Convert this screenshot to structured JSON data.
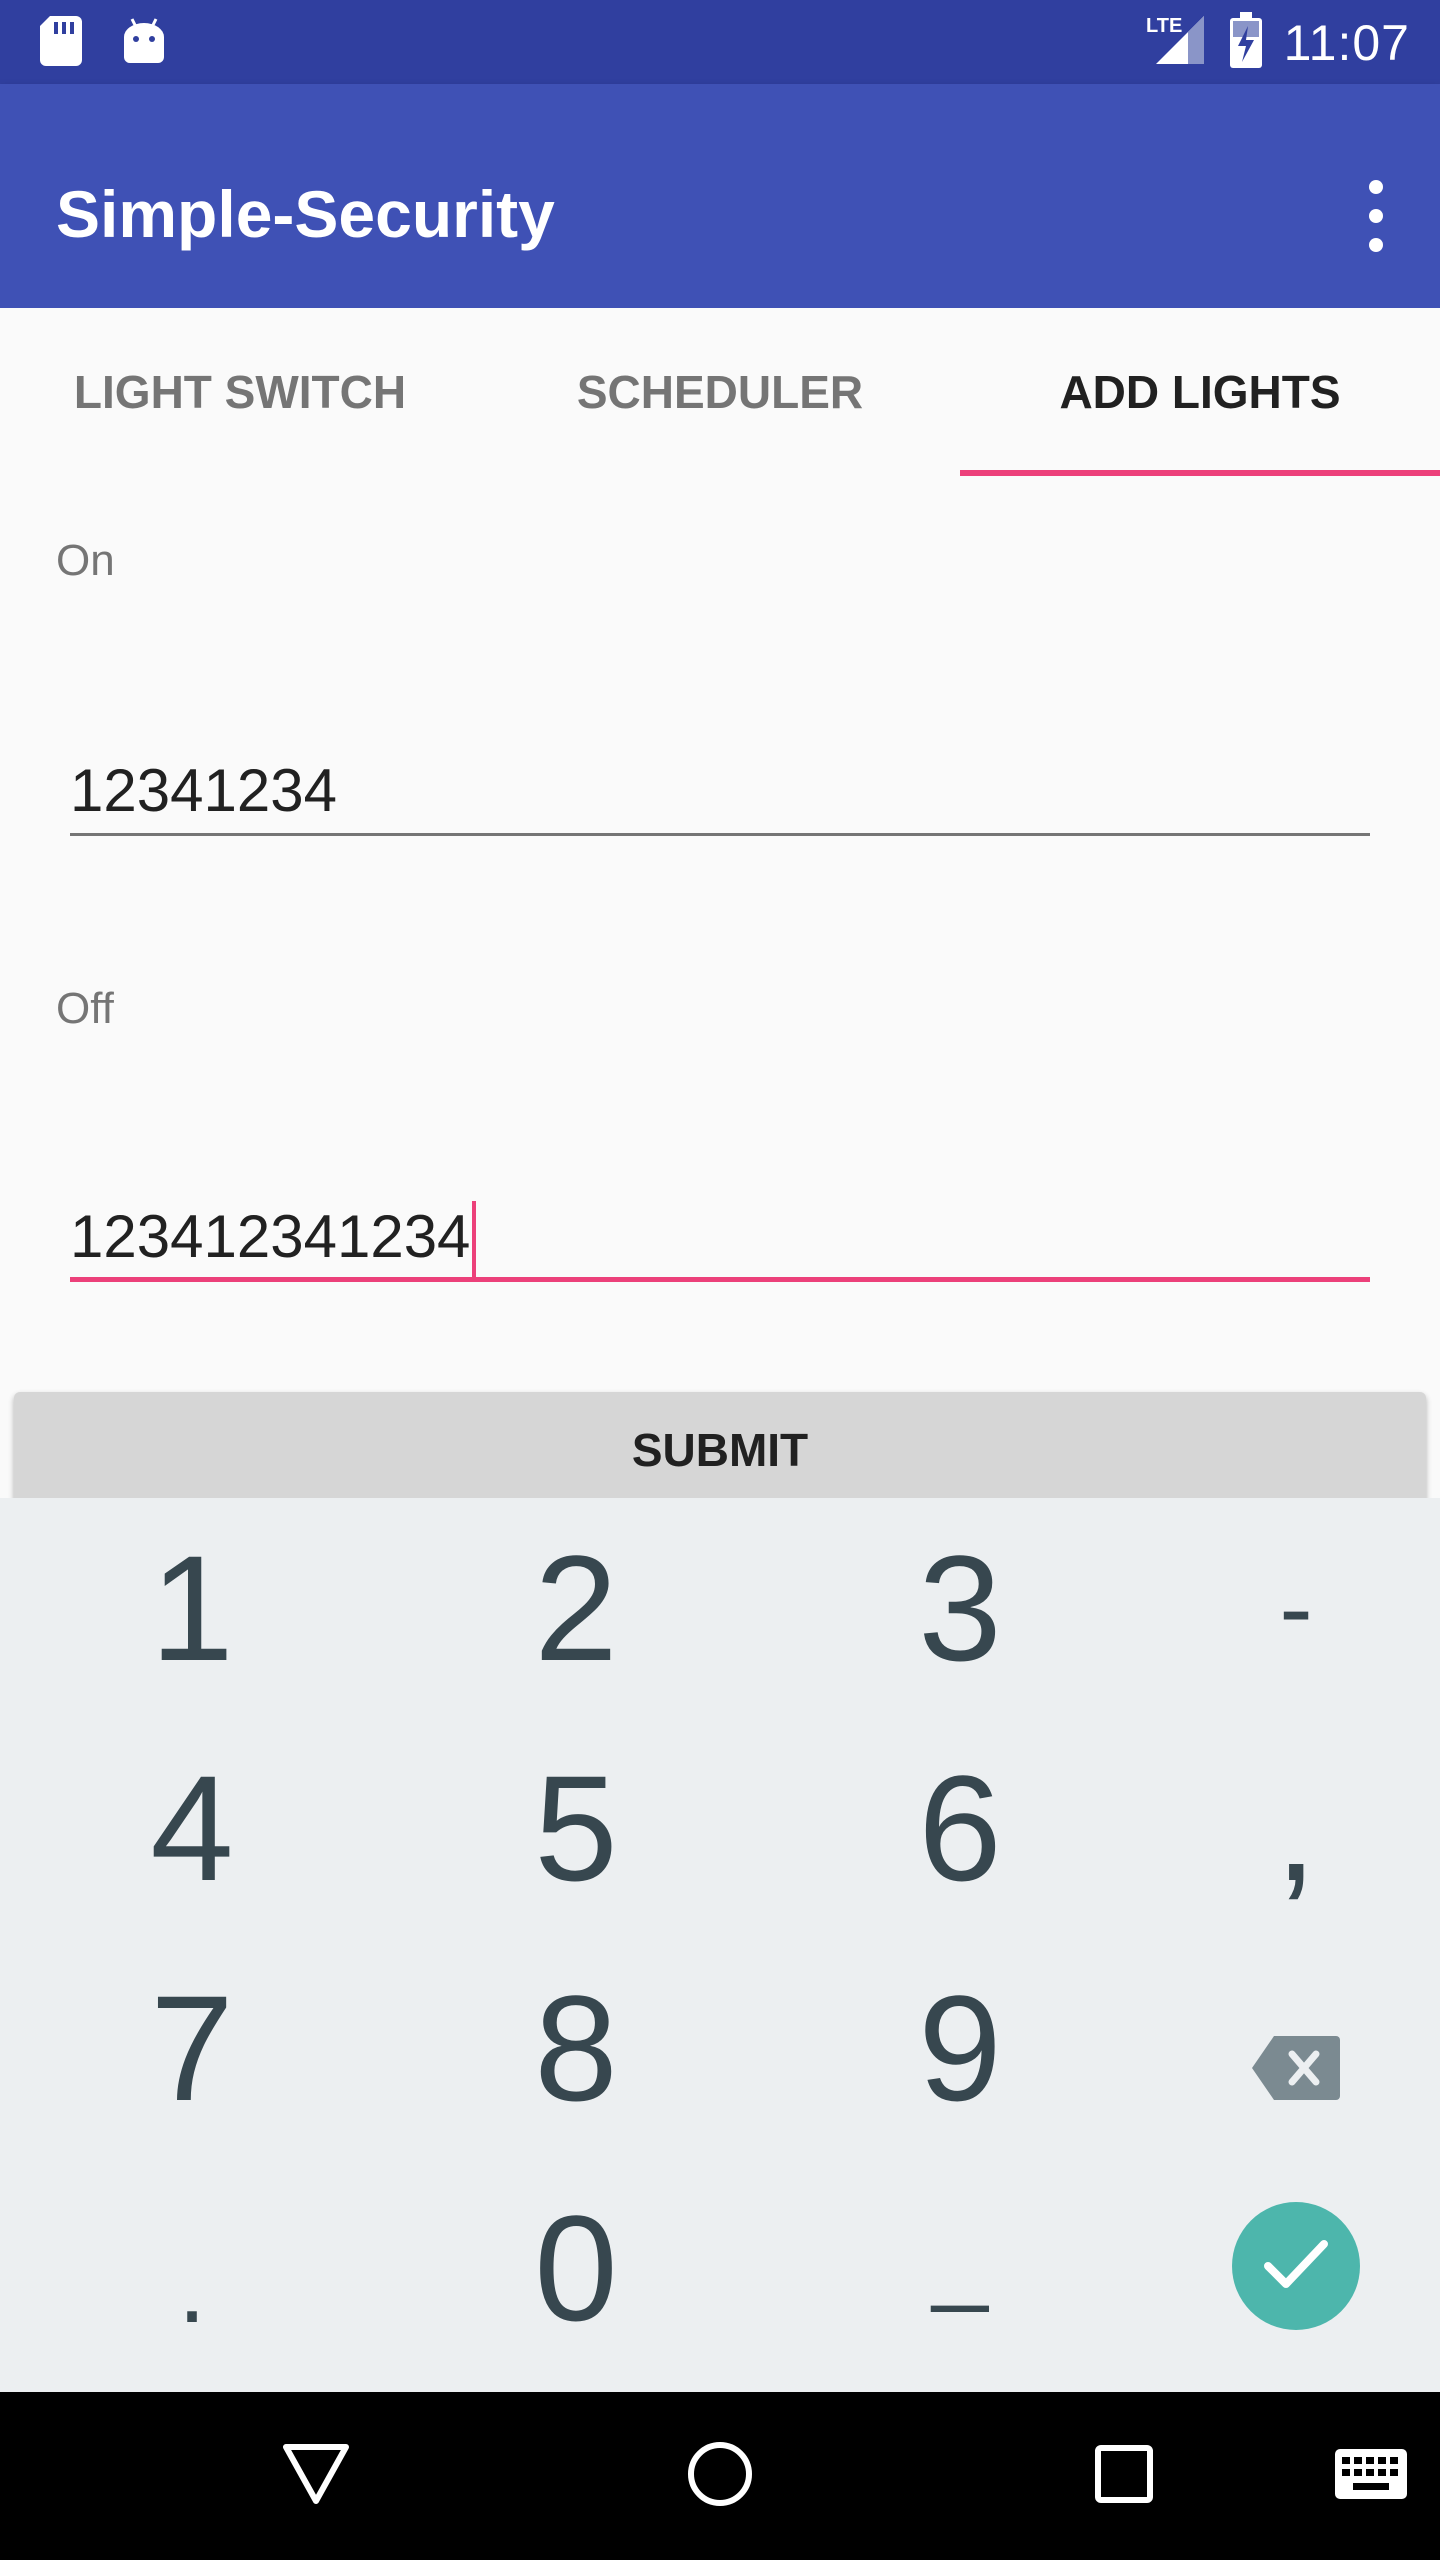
{
  "status_bar": {
    "time": "11:07",
    "network": "LTE",
    "icons": [
      "sd-card-icon",
      "android-icon",
      "lte-signal-icon",
      "battery-charging-icon"
    ]
  },
  "app_bar": {
    "title": "Simple-Security",
    "overflow_icon": "more-vert-icon"
  },
  "tabs": [
    {
      "label": "LIGHT SWITCH"
    },
    {
      "label": "SCHEDULER"
    },
    {
      "label": "ADD LIGHTS"
    }
  ],
  "active_tab": "ADD LIGHTS",
  "form": {
    "on_label": "On",
    "on_value": "12341234",
    "off_label": "Off",
    "off_value": "123412341234",
    "submit_label": "SUBMIT"
  },
  "keyboard": {
    "keys": [
      "1",
      "2",
      "3",
      "-",
      "4",
      "5",
      "6",
      ",",
      "7",
      "8",
      "9",
      ".",
      "0",
      "_"
    ],
    "icons": [
      "backspace-icon",
      "check-icon"
    ]
  },
  "nav_bar": {
    "icons": [
      "back-icon",
      "home-icon",
      "recents-icon",
      "keyboard-icon"
    ]
  },
  "colors": {
    "status_bar": "#303f9f",
    "primary": "#3f51b5",
    "accent": "#ec407a",
    "enter_key": "#4db6ac",
    "keyboard_bg": "#eceff1"
  }
}
